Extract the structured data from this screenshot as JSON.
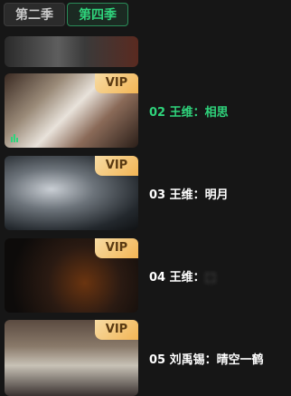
{
  "tabs": [
    {
      "label": "第二季",
      "active": false
    },
    {
      "label": "第四季",
      "active": true
    }
  ],
  "badge": "VIP",
  "episodes": [
    {
      "title": "02 王维：相思",
      "playing": true
    },
    {
      "title": "03 王维：明月",
      "playing": false
    },
    {
      "title": "04 王维：",
      "title_obscured": "⬚",
      "playing": false
    },
    {
      "title": "05 刘禹锡：晴空一鹤",
      "playing": false
    }
  ],
  "colors": {
    "accent": "#2fd47c",
    "background": "#161616",
    "vip_gold": "#f2b555",
    "tab_bg": "#2b2b2b"
  }
}
